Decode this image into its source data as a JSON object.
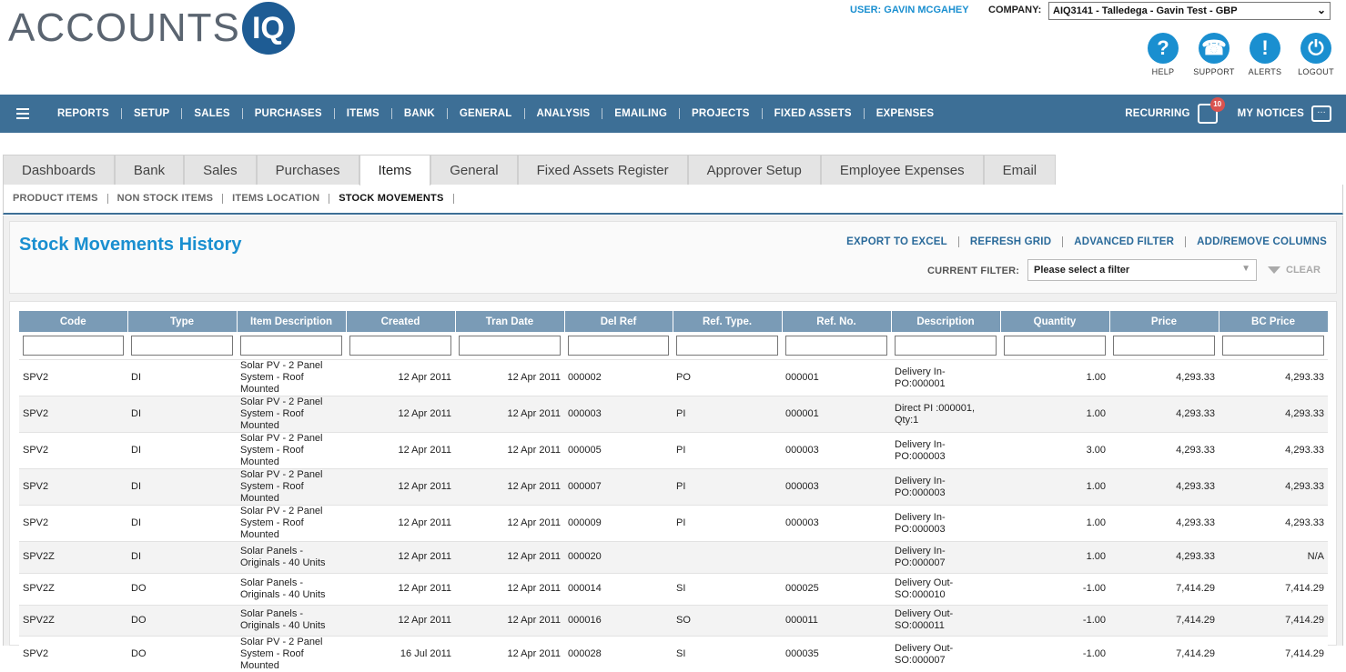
{
  "header": {
    "logo_text": "ACCOUNTS",
    "logo_mark": "IQ",
    "user_label": "USER: GAVIN MCGAHEY",
    "company_label": "COMPANY:",
    "company_value": "AIQ3141 - Talledega - Gavin Test - GBP",
    "icons": [
      {
        "icon": "help-icon",
        "glyph": "?",
        "label": "HELP"
      },
      {
        "icon": "support-icon",
        "glyph": "☎",
        "label": "SUPPORT"
      },
      {
        "icon": "alerts-icon",
        "glyph": "!",
        "label": "ALERTS"
      },
      {
        "icon": "logout-icon",
        "glyph": "⏻",
        "label": "LOGOUT"
      }
    ]
  },
  "nav": {
    "items": [
      "REPORTS",
      "SETUP",
      "SALES",
      "PURCHASES",
      "ITEMS",
      "BANK",
      "GENERAL",
      "ANALYSIS",
      "EMAILING",
      "PROJECTS",
      "FIXED ASSETS",
      "EXPENSES"
    ],
    "recurring": "RECURRING",
    "recurring_badge": "10",
    "notices": "MY NOTICES"
  },
  "tabs": [
    "Dashboards",
    "Bank",
    "Sales",
    "Purchases",
    "Items",
    "General",
    "Fixed Assets Register",
    "Approver Setup",
    "Employee Expenses",
    "Email"
  ],
  "active_tab": "Items",
  "subtabs": [
    "PRODUCT ITEMS",
    "NON STOCK ITEMS",
    "ITEMS LOCATION",
    "STOCK MOVEMENTS"
  ],
  "active_subtab": "STOCK MOVEMENTS",
  "page": {
    "title": "Stock Movements History",
    "actions": [
      "EXPORT TO EXCEL",
      "REFRESH GRID",
      "ADVANCED FILTER",
      "ADD/REMOVE COLUMNS"
    ],
    "filter_label": "CURRENT FILTER:",
    "filter_value": "Please select a filter",
    "clear_label": "CLEAR"
  },
  "grid": {
    "columns": [
      "Code",
      "Type",
      "Item Description",
      "Created",
      "Tran Date",
      "Del Ref",
      "Ref. Type.",
      "Ref. No.",
      "Description",
      "Quantity",
      "Price",
      "BC Price"
    ],
    "rows": [
      [
        "SPV2",
        "DI",
        "Solar PV - 2 Panel System - Roof Mounted",
        "12 Apr 2011",
        "12 Apr 2011",
        "000002",
        "PO",
        "000001",
        "Delivery In- PO:000001",
        "1.00",
        "4,293.33",
        "4,293.33"
      ],
      [
        "SPV2",
        "DI",
        "Solar PV - 2 Panel System - Roof Mounted",
        "12 Apr 2011",
        "12 Apr 2011",
        "000003",
        "PI",
        "000001",
        "Direct PI :000001, Qty:1",
        "1.00",
        "4,293.33",
        "4,293.33"
      ],
      [
        "SPV2",
        "DI",
        "Solar PV - 2 Panel System - Roof Mounted",
        "12 Apr 2011",
        "12 Apr 2011",
        "000005",
        "PI",
        "000003",
        "Delivery In- PO:000003",
        "3.00",
        "4,293.33",
        "4,293.33"
      ],
      [
        "SPV2",
        "DI",
        "Solar PV - 2 Panel System - Roof Mounted",
        "12 Apr 2011",
        "12 Apr 2011",
        "000007",
        "PI",
        "000003",
        "Delivery In- PO:000003",
        "1.00",
        "4,293.33",
        "4,293.33"
      ],
      [
        "SPV2",
        "DI",
        "Solar PV - 2 Panel System - Roof Mounted",
        "12 Apr 2011",
        "12 Apr 2011",
        "000009",
        "PI",
        "000003",
        "Delivery In- PO:000003",
        "1.00",
        "4,293.33",
        "4,293.33"
      ],
      [
        "SPV2Z",
        "DI",
        "Solar Panels - Originals - 40 Units",
        "12 Apr 2011",
        "12 Apr 2011",
        "000020",
        "",
        "",
        "Delivery In- PO:000007",
        "1.00",
        "4,293.33",
        "N/A"
      ],
      [
        "SPV2Z",
        "DO",
        "Solar Panels - Originals - 40 Units",
        "12 Apr 2011",
        "12 Apr 2011",
        "000014",
        "SI",
        "000025",
        "Delivery Out- SO:000010",
        "-1.00",
        "7,414.29",
        "7,414.29"
      ],
      [
        "SPV2Z",
        "DO",
        "Solar Panels - Originals - 40 Units",
        "12 Apr 2011",
        "12 Apr 2011",
        "000016",
        "SO",
        "000011",
        "Delivery Out- SO:000011",
        "-1.00",
        "7,414.29",
        "7,414.29"
      ],
      [
        "SPV2",
        "DO",
        "Solar PV - 2 Panel System - Roof Mounted",
        "16 Jul 2011",
        "12 Apr 2011",
        "000028",
        "SI",
        "000035",
        "Delivery Out- SO:000007",
        "-1.00",
        "7,414.29",
        "7,414.29"
      ]
    ]
  }
}
